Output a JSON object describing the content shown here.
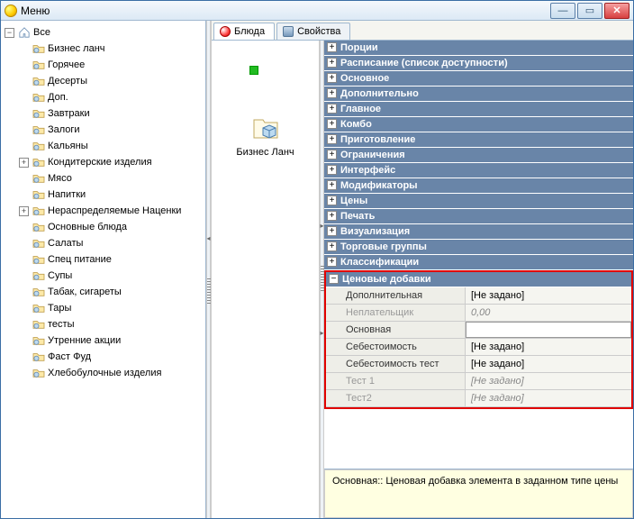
{
  "window": {
    "title": "Меню"
  },
  "tree": {
    "root": {
      "label": "Все",
      "expanded": true
    },
    "items": [
      {
        "label": "Бизнес ланч",
        "exp": ""
      },
      {
        "label": "Горячее",
        "exp": ""
      },
      {
        "label": "Десерты",
        "exp": ""
      },
      {
        "label": "Доп.",
        "exp": ""
      },
      {
        "label": "Завтраки",
        "exp": ""
      },
      {
        "label": "Залоги",
        "exp": ""
      },
      {
        "label": "Кальяны",
        "exp": ""
      },
      {
        "label": "Кондитерские изделия",
        "exp": "+"
      },
      {
        "label": "Мясо",
        "exp": ""
      },
      {
        "label": "Напитки",
        "exp": ""
      },
      {
        "label": "Нераспределяемые Наценки",
        "exp": "+"
      },
      {
        "label": "Основные блюда",
        "exp": ""
      },
      {
        "label": "Салаты",
        "exp": ""
      },
      {
        "label": "Спец питание",
        "exp": ""
      },
      {
        "label": "Супы",
        "exp": ""
      },
      {
        "label": "Табак, сигареты",
        "exp": ""
      },
      {
        "label": "Тары",
        "exp": ""
      },
      {
        "label": "тесты",
        "exp": ""
      },
      {
        "label": "Утренние акции",
        "exp": ""
      },
      {
        "label": "Фаст Фуд",
        "exp": ""
      },
      {
        "label": "Хлебобулочные изделия",
        "exp": ""
      }
    ]
  },
  "tabs": {
    "0": "Блюда",
    "1": "Свойства"
  },
  "iconItem": {
    "label": "Бизнес Ланч"
  },
  "categories": [
    "Порции",
    "Расписание (список доступности)",
    "Основное",
    "Дополнительно",
    "Главное",
    "Комбо",
    "Приготовление",
    "Ограничения",
    "Интерфейс",
    "Модификаторы",
    "Цены",
    "Печать",
    "Визуализация",
    "Торговые группы",
    "Классификации"
  ],
  "openCategory": "Ценовые добавки",
  "props": [
    {
      "label": "Дополнительная",
      "value": "[Не задано]",
      "dim": false
    },
    {
      "label": "Неплательщик",
      "value": "0,00",
      "dim": true
    },
    {
      "label": "Основная",
      "value": "",
      "dim": false,
      "selected": true
    },
    {
      "label": "Себестоимость",
      "value": "[Не задано]",
      "dim": false
    },
    {
      "label": "Себестоимость тест",
      "value": "[Не задано]",
      "dim": false
    },
    {
      "label": "Тест 1",
      "value": "[Не задано]",
      "dim": true
    },
    {
      "label": "Тест2",
      "value": "[Не задано]",
      "dim": true
    }
  ],
  "help": "Основная:: Ценовая добавка элемента в заданном типе цены"
}
